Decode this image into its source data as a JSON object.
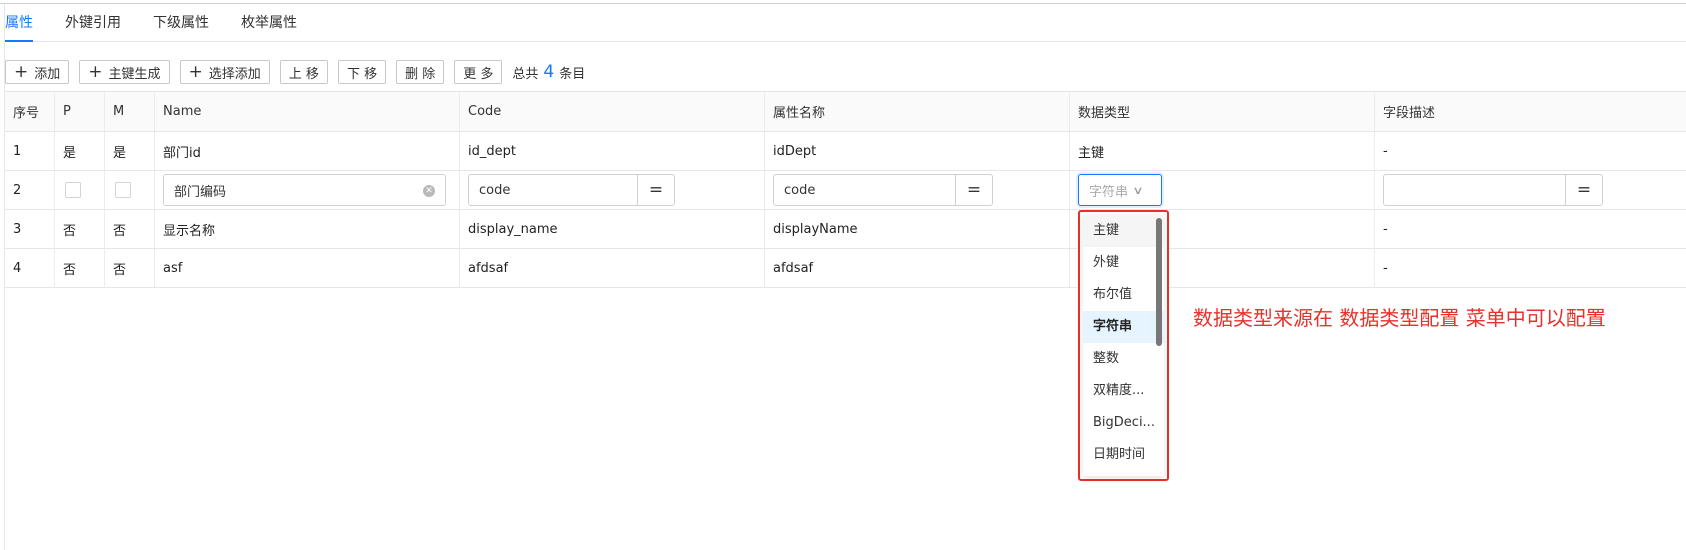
{
  "tabs": [
    {
      "label": "属性",
      "active": true
    },
    {
      "label": "外键引用",
      "active": false
    },
    {
      "label": "下级属性",
      "active": false
    },
    {
      "label": "枚举属性",
      "active": false
    }
  ],
  "toolbar": {
    "add_label": "添加",
    "pk_gen_label": "主键生成",
    "select_add_label": "选择添加",
    "move_up_label": "上 移",
    "move_down_label": "下 移",
    "delete_label": "删 除",
    "more_label": "更 多",
    "total_prefix": "总共",
    "total_count": "4",
    "total_suffix": "条目"
  },
  "table": {
    "headers": [
      "序号",
      "P",
      "M",
      "Name",
      "Code",
      "属性名称",
      "数据类型",
      "字段描述"
    ],
    "rows": [
      {
        "index": "1",
        "p": "是",
        "m": "是",
        "name": "部门id",
        "code": "id_dept",
        "attr": "idDept",
        "type": "主键",
        "desc": "-"
      },
      {
        "index": "2",
        "name_input": "部门编码",
        "code_input": "code",
        "attr_input": "code",
        "type_placeholder": "字符串",
        "eq": "="
      },
      {
        "index": "3",
        "p": "否",
        "m": "否",
        "name": "显示名称",
        "code": "display_name",
        "attr": "displayName",
        "type": "",
        "desc": "-"
      },
      {
        "index": "4",
        "p": "否",
        "m": "否",
        "name": "asf",
        "code": "afdsaf",
        "attr": "afdsaf",
        "type": "",
        "desc": "-"
      }
    ]
  },
  "dropdown": {
    "options": [
      "主键",
      "外键",
      "布尔值",
      "字符串",
      "整数",
      "双精度...",
      "BigDeci...",
      "日期时间"
    ],
    "selected": "字符串"
  },
  "annotation": "数据类型来源在 数据类型配置 菜单中可以配置",
  "colors": {
    "accent": "#1677ff",
    "annotation": "#e8302c"
  }
}
